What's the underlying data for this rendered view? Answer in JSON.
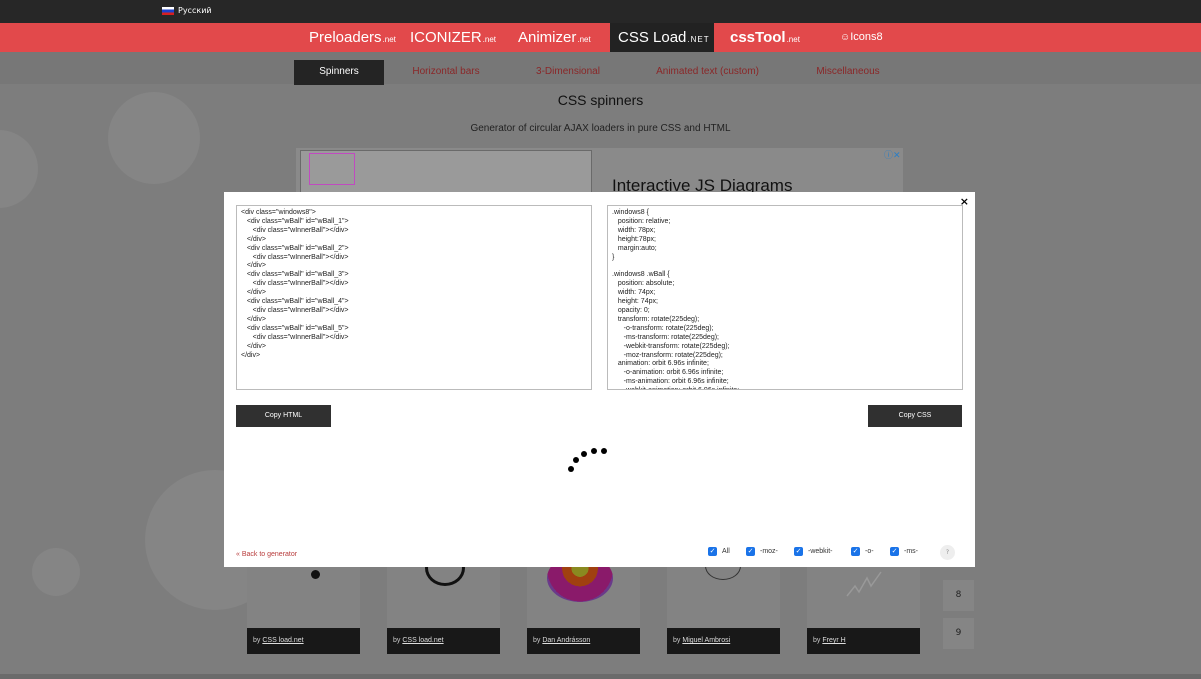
{
  "topbar": {
    "language": "Русский"
  },
  "sites": [
    {
      "label": "Preloaders",
      "suffix": ".net"
    },
    {
      "label": "ICONIZER",
      "suffix": ".net"
    },
    {
      "label": "Animizer",
      "suffix": ".net"
    },
    {
      "label": "CSS Load",
      "suffix": ".NET"
    },
    {
      "label": "cssTool",
      "suffix": ".net"
    },
    {
      "label": "Icons8",
      "suffix": ""
    }
  ],
  "tabs": [
    {
      "label": "Spinners"
    },
    {
      "label": "Horizontal bars"
    },
    {
      "label": "3-Dimensional"
    },
    {
      "label": "Animated text (custom)"
    },
    {
      "label": "Miscellaneous"
    }
  ],
  "page": {
    "title": "CSS spinners",
    "subtitle": "Generator of circular AJAX loaders in pure CSS and HTML"
  },
  "ad": {
    "headline": "Interactive JS Diagrams"
  },
  "cards": [
    {
      "by": "by",
      "author": "CSS load.net"
    },
    {
      "by": "by",
      "author": "CSS load.net"
    },
    {
      "by": "by",
      "author": "Dan Andrásson"
    },
    {
      "by": "by",
      "author": "Miguel Ambrosi"
    },
    {
      "by": "by",
      "author": "Freyr H"
    }
  ],
  "pagination": [
    "8",
    "9"
  ],
  "modal": {
    "close": "×",
    "html_code": "<div class=\"windows8\">\n\t<div class=\"wBall\" id=\"wBall_1\">\n\t\t<div class=\"wInnerBall\"></div>\n\t</div>\n\t<div class=\"wBall\" id=\"wBall_2\">\n\t\t<div class=\"wInnerBall\"></div>\n\t</div>\n\t<div class=\"wBall\" id=\"wBall_3\">\n\t\t<div class=\"wInnerBall\"></div>\n\t</div>\n\t<div class=\"wBall\" id=\"wBall_4\">\n\t\t<div class=\"wInnerBall\"></div>\n\t</div>\n\t<div class=\"wBall\" id=\"wBall_5\">\n\t\t<div class=\"wInnerBall\"></div>\n\t</div>\n</div>",
    "css_code": ".windows8 {\n\tposition: relative;\n\twidth: 78px;\n\theight:78px;\n\tmargin:auto;\n}\n\n.windows8 .wBall {\n\tposition: absolute;\n\twidth: 74px;\n\theight: 74px;\n\topacity: 0;\n\ttransform: rotate(225deg);\n\t\t-o-transform: rotate(225deg);\n\t\t-ms-transform: rotate(225deg);\n\t\t-webkit-transform: rotate(225deg);\n\t\t-moz-transform: rotate(225deg);\n\tanimation: orbit 6.96s infinite;\n\t\t-o-animation: orbit 6.96s infinite;\n\t\t-ms-animation: orbit 6.96s infinite;\n\t\t-webkit-animation: orbit 6.96s infinite;",
    "copy_html": "Copy HTML",
    "copy_css": "Copy CSS",
    "back_link": "« Back to generator",
    "options": [
      {
        "label": "All",
        "checked": true
      },
      {
        "label": "-moz-",
        "checked": true
      },
      {
        "label": "-webkit-",
        "checked": true
      },
      {
        "label": "-o-",
        "checked": true
      },
      {
        "label": "-ms-",
        "checked": true
      }
    ],
    "help": "?"
  },
  "colors": {
    "brand_red": "#e2494b",
    "dark": "#272727",
    "overlay": "#7d7d7d",
    "checkbox": "#1a73e8"
  }
}
